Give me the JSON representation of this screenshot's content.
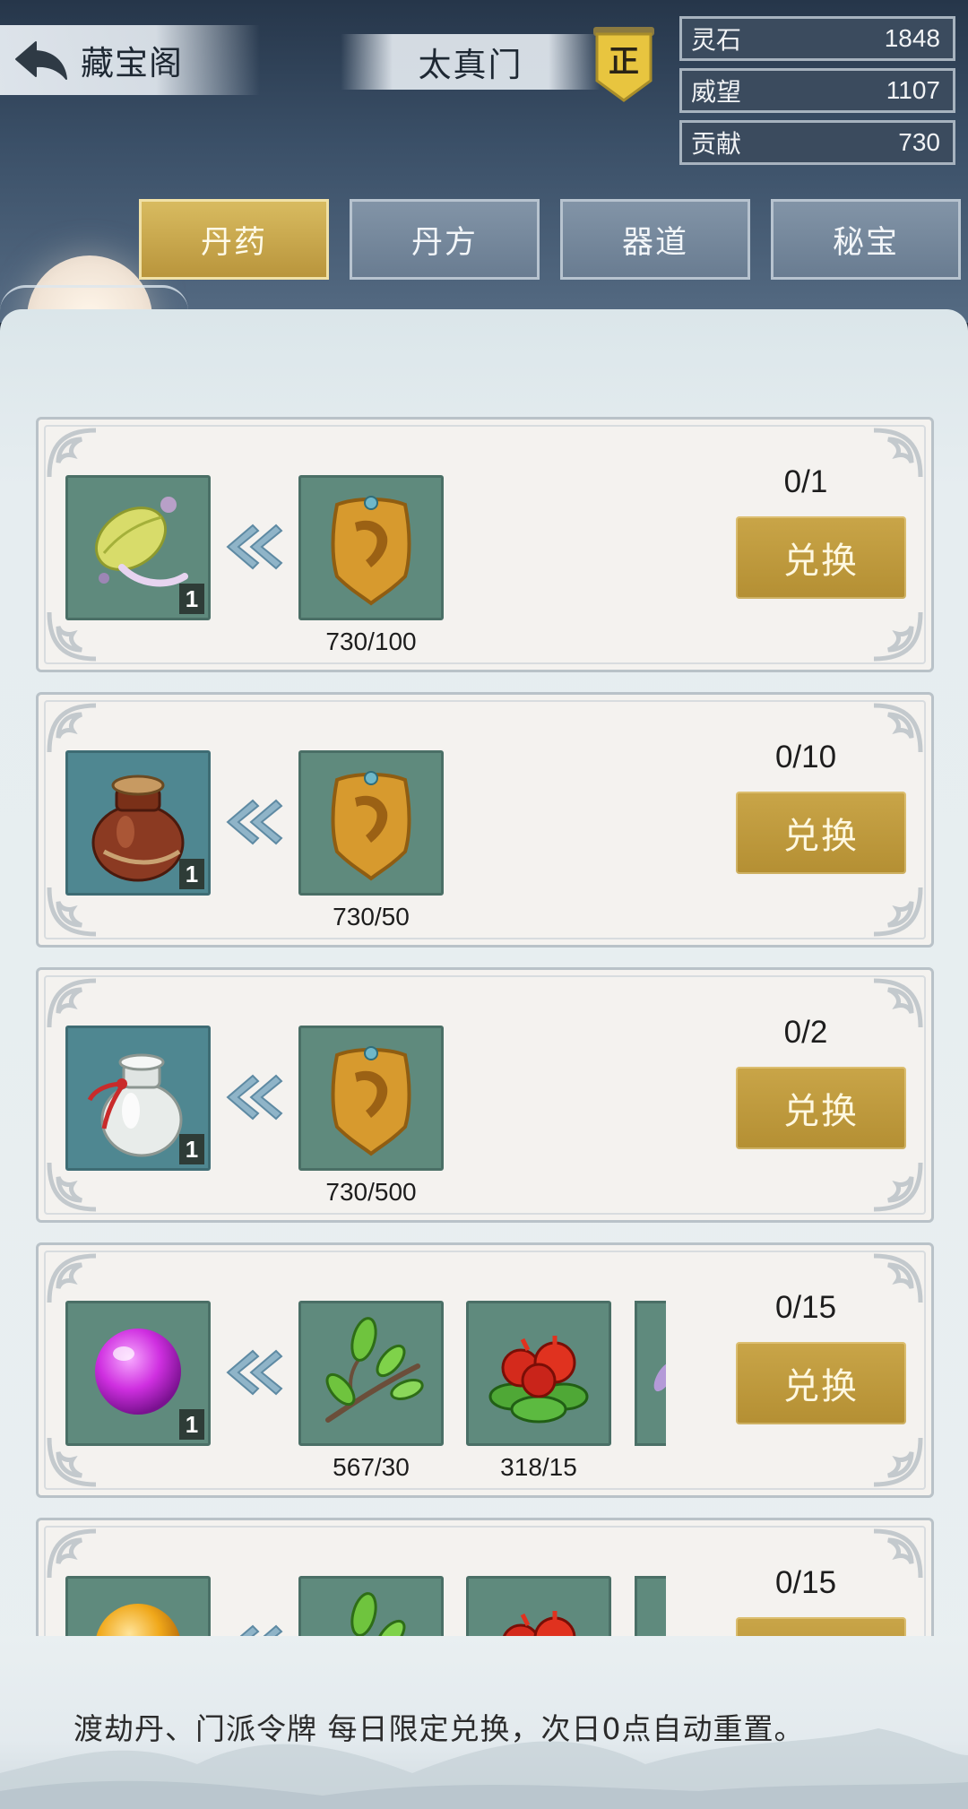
{
  "header": {
    "back_label": "藏宝阁",
    "sect_name": "太真门",
    "sect_badge": "正"
  },
  "resources": [
    {
      "label": "灵石",
      "value": "1848"
    },
    {
      "label": "威望",
      "value": "1107"
    },
    {
      "label": "贡献",
      "value": "730"
    }
  ],
  "tabs": [
    {
      "label": "丹药",
      "active": true
    },
    {
      "label": "丹方",
      "active": false
    },
    {
      "label": "器道",
      "active": false
    },
    {
      "label": "秘宝",
      "active": false
    }
  ],
  "items": [
    {
      "reward_icon": "bead-pendant-icon",
      "reward_qty": "1",
      "costs": [
        {
          "icon": "sect-token-icon",
          "text": "730/100"
        }
      ],
      "limit": "0/1",
      "button": "兑换"
    },
    {
      "reward_icon": "brown-jar-icon",
      "reward_qty": "1",
      "costs": [
        {
          "icon": "sect-token-icon",
          "text": "730/50"
        }
      ],
      "limit": "0/10",
      "button": "兑换"
    },
    {
      "reward_icon": "white-jar-icon",
      "reward_qty": "1",
      "costs": [
        {
          "icon": "sect-token-icon",
          "text": "730/500"
        }
      ],
      "limit": "0/2",
      "button": "兑换"
    },
    {
      "reward_icon": "purple-pill-icon",
      "reward_qty": "1",
      "costs": [
        {
          "icon": "herb-branch-icon",
          "text": "567/30"
        },
        {
          "icon": "red-fruit-icon",
          "text": "318/15"
        }
      ],
      "limit": "0/15",
      "button": "兑换"
    },
    {
      "reward_icon": "golden-pill-icon",
      "reward_qty": "",
      "costs": [
        {
          "icon": "herb-branch-icon",
          "text": ""
        },
        {
          "icon": "red-fruit-icon",
          "text": ""
        }
      ],
      "limit": "0/15",
      "button": ""
    }
  ],
  "footer": {
    "notice": "渡劫丹、门派令牌 每日限定兑换，次日0点自动重置。"
  },
  "colors": {
    "gold_button": "#c9a548",
    "slot_green": "#5f8a7d",
    "header_dark": "#26364a"
  }
}
